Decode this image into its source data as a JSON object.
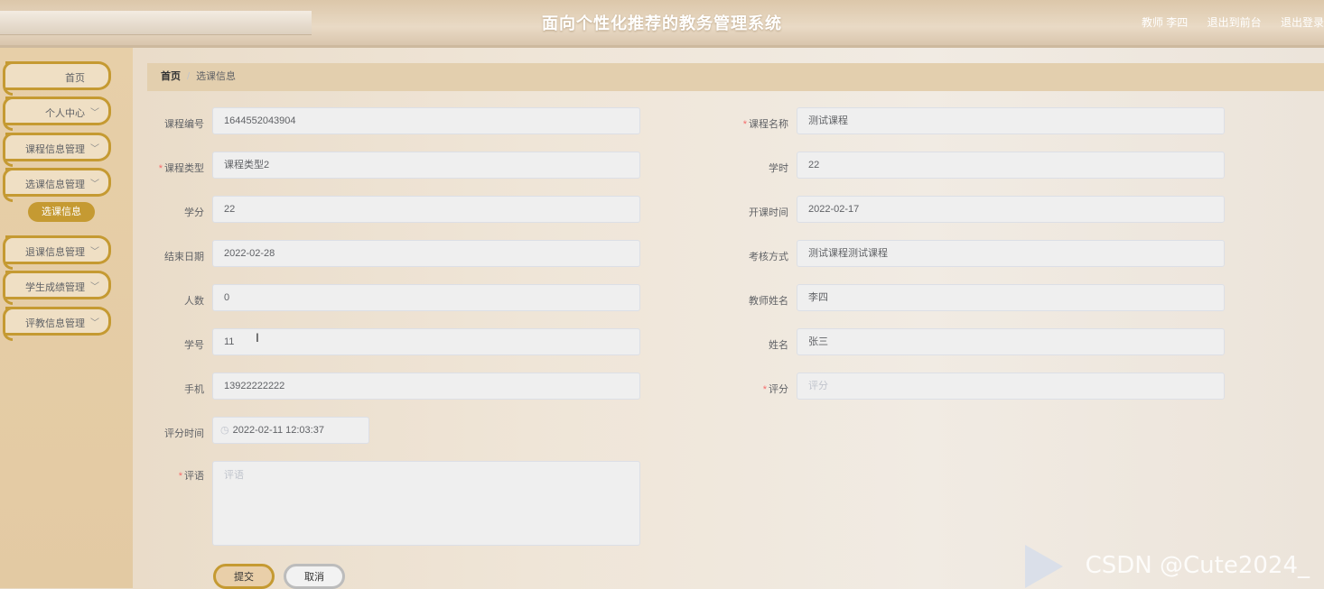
{
  "header": {
    "title": "面向个性化推荐的教务管理系统",
    "user_role": "教师 李四",
    "to_front": "退出到前台",
    "logout": "退出登录"
  },
  "sidebar": {
    "items": [
      {
        "label": "首页"
      },
      {
        "label": "个人中心"
      },
      {
        "label": "课程信息管理"
      },
      {
        "label": "选课信息管理"
      },
      {
        "label": "退课信息管理"
      },
      {
        "label": "学生成绩管理"
      },
      {
        "label": "评教信息管理"
      }
    ],
    "sub_active": "选课信息"
  },
  "breadcrumb": {
    "home": "首页",
    "separator": "/",
    "current": "选课信息"
  },
  "form": {
    "course_no": {
      "label": "课程编号",
      "value": "1644552043904"
    },
    "course_name": {
      "label": "课程名称",
      "value": "测试课程"
    },
    "course_type": {
      "label": "课程类型",
      "value": "课程类型2"
    },
    "hours": {
      "label": "学时",
      "value": "22"
    },
    "credits": {
      "label": "学分",
      "value": "22"
    },
    "start_time": {
      "label": "开课时间",
      "value": "2022-02-17"
    },
    "end_date": {
      "label": "结束日期",
      "value": "2022-02-28"
    },
    "assessment": {
      "label": "考核方式",
      "value": "测试课程测试课程"
    },
    "count": {
      "label": "人数",
      "value": "0"
    },
    "teacher_name": {
      "label": "教师姓名",
      "value": "李四"
    },
    "student_no": {
      "label": "学号",
      "value": "11"
    },
    "name": {
      "label": "姓名",
      "value": "张三"
    },
    "phone": {
      "label": "手机",
      "value": "13922222222"
    },
    "score": {
      "label": "评分",
      "placeholder": "评分"
    },
    "score_time": {
      "label": "评分时间",
      "value": "2022-02-11 12:03:37"
    },
    "comment": {
      "label": "评语",
      "placeholder": "评语"
    },
    "required_mark": "*"
  },
  "buttons": {
    "submit": "提交",
    "cancel": "取消"
  },
  "watermark": "CSDN @Cute2024_"
}
